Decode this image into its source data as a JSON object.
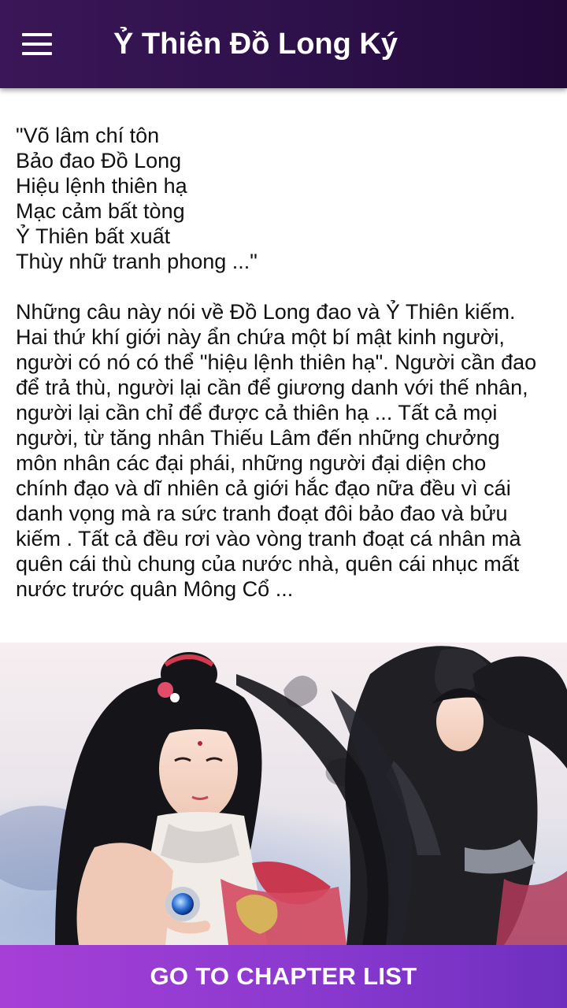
{
  "toolbar": {
    "menu_icon": "hamburger-menu-icon",
    "title": "Ỷ Thiên Đồ Long Ký"
  },
  "content": {
    "poem": [
      "\"Võ lâm chí tôn",
      "Bảo đao Đồ Long",
      "Hiệu lệnh thiên hạ",
      "Mạc cảm bất tòng",
      "Ỷ Thiên bất xuất",
      "Thùy nhữ tranh phong ...\""
    ],
    "paragraph": [
      "Những câu này nói về Đồ Long đao và Ỷ Thiên kiếm.",
      "Hai thứ khí giới này ẩn chứa một bí mật kinh người,",
      "người có nó có thể \"hiệu lệnh thiên hạ\". Người cần đao",
      "để trả thù, người lại cần để giương danh với thế nhân,",
      "người lại cần chỉ để được cả thiên hạ ... Tất cả mọi",
      "người, từ tăng nhân Thiếu Lâm đến những chưởng",
      "môn nhân các đại phái, những người đại diện cho",
      "chính đạo và dĩ nhiên cả giới hắc đạo nữa đều vì cái",
      "danh vọng mà ra sức tranh đoạt đôi bảo đao và bửu",
      "kiếm . Tất cả đều rơi vào vòng tranh đoạt cá nhân mà",
      "quên cái thù chung của nước nhà, quên cái nhục mất",
      "nước trước quân Mông Cổ ..."
    ]
  },
  "colors": {
    "toolbar": "#2c1048",
    "bottom_bar": "#8a39cf",
    "text": "#111111"
  },
  "bottom_bar": {
    "label": "GO TO CHAPTER LIST"
  }
}
